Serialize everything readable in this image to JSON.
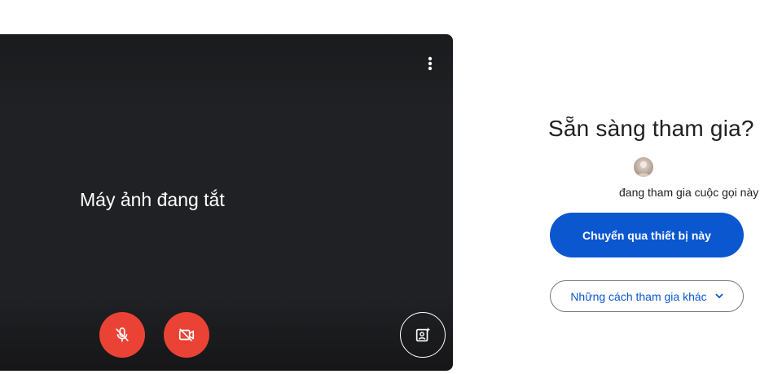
{
  "preview": {
    "camera_status": "Máy ảnh đang tắt",
    "icons": {
      "more": "more-vert-icon",
      "mic": "mic-off-icon",
      "camera": "videocam-off-icon",
      "effects": "visual-effects-icon"
    },
    "colors": {
      "background": "#202124",
      "off_button": "#ea4335"
    }
  },
  "join": {
    "title": "Sẵn sàng tham gia?",
    "in_call_text": "đang tham gia cuộc gọi này",
    "switch_button_label": "Chuyển qua thiết bị này",
    "other_ways_label": "Những cách tham gia khác",
    "colors": {
      "primary": "#0b57d0"
    }
  }
}
